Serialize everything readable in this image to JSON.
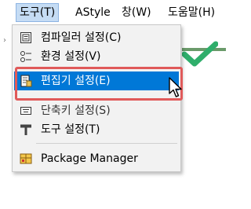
{
  "menubar": {
    "items": [
      {
        "label": "도구(T)",
        "active": true
      },
      {
        "label": "AStyle",
        "active": false
      },
      {
        "label": "창(W)",
        "active": false
      },
      {
        "label": "도움말(H)",
        "active": false
      }
    ]
  },
  "menu": {
    "items": [
      {
        "label": "컴파일러 설정(C)",
        "icon": "compiler-settings-icon"
      },
      {
        "label": "환경 설정(V)",
        "icon": "environment-settings-icon"
      },
      {
        "label": "편집기 설정(E)",
        "icon": "editor-settings-icon",
        "highlighted": true
      },
      {
        "label": "단축키 설정(S)",
        "icon": "shortcut-settings-icon"
      },
      {
        "label": "도구 설정(T)",
        "icon": "hammer-icon"
      },
      {
        "label": "Package Manager",
        "icon": "package-manager-icon"
      }
    ]
  },
  "colors": {
    "highlight": "#0078d7",
    "annotation": "#e05a5a",
    "checkmark": "#2fae6b"
  }
}
